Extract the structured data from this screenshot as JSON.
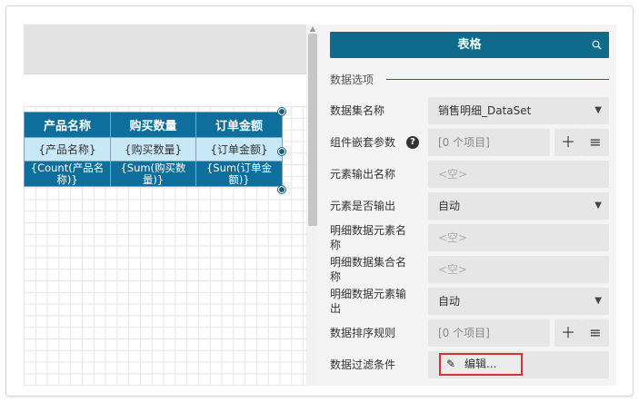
{
  "canvas": {
    "table": {
      "header": [
        "产品名称",
        "购买数量",
        "订单金额"
      ],
      "detail": [
        "{产品名称}",
        "{购买数量}",
        "{订单金额}"
      ],
      "summary": [
        "{Count(产品名称)}",
        "{Sum(购买数量)}",
        "{Sum(订单金额)}"
      ]
    }
  },
  "panel": {
    "title": "表格",
    "search_icon": "search-icon",
    "section_title": "数据选项",
    "rows": {
      "dataset": {
        "label": "数据集名称",
        "value": "销售明细_DataSet"
      },
      "nested_params": {
        "label": "组件嵌套参数",
        "help": "?",
        "value": "[0 个项目]"
      },
      "element_output_name": {
        "label": "元素输出名称",
        "placeholder": "<空>"
      },
      "element_is_output": {
        "label": "元素是否输出",
        "value": "自动"
      },
      "detail_element_name": {
        "label": "明细数据元素名称",
        "placeholder": "<空>"
      },
      "detail_collection_name": {
        "label": "明细数据集合名称",
        "placeholder": "<空>"
      },
      "detail_element_output": {
        "label": "明细数据元素输出",
        "value": "自动"
      },
      "sort_rules": {
        "label": "数据排序规则",
        "value": "[0 个项目]"
      },
      "filter": {
        "label": "数据过滤条件",
        "button": "编辑..."
      }
    }
  },
  "colors": {
    "header_blue": "#0f6a8c",
    "cell_light": "#c9e8f7",
    "highlight_red": "#d9322e"
  }
}
